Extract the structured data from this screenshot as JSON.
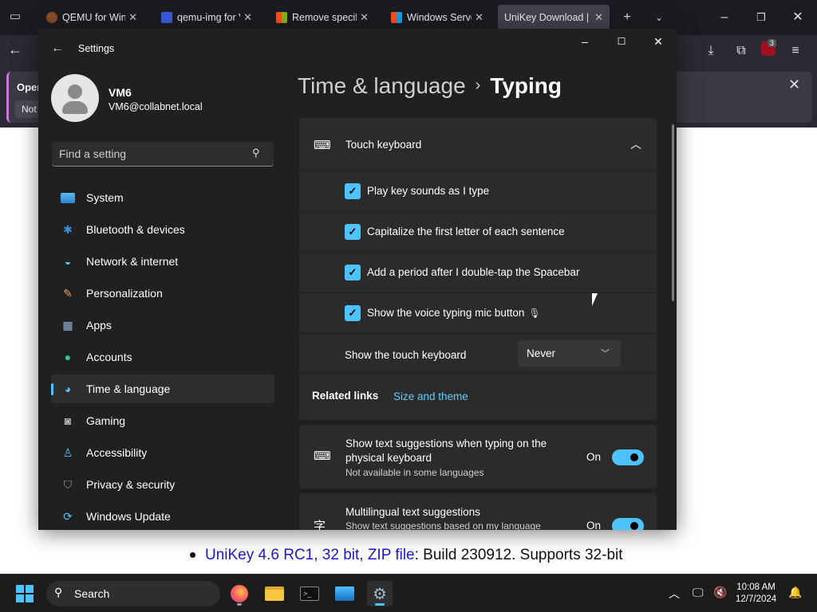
{
  "browser": {
    "tabs": [
      {
        "label": "QEMU for Wind",
        "fav_color": "#8b4a2b"
      },
      {
        "label": "qemu-img for V",
        "fav_color": "#3b5bdb"
      },
      {
        "label": "Remove specific",
        "fav_color": "#f25022"
      },
      {
        "label": "Windows Server",
        "fav_color": "#00a4ef"
      },
      {
        "label": "UniKey Download | ",
        "fav_color": ""
      }
    ],
    "notification": {
      "title": "Open",
      "button": "Not"
    },
    "badge_count": "3"
  },
  "page": {
    "bullet_link": "UniKey 4.6 RC1, 32 bit, ZIP file",
    "bullet_rest": ": Build 230912. Supports 32-bit"
  },
  "settings": {
    "title": "Settings",
    "user": {
      "name": "VM6",
      "email": "VM6@collabnet.local"
    },
    "search_placeholder": "Find a setting",
    "nav": [
      {
        "label": "System",
        "icon": "monitor-icon",
        "selected": false
      },
      {
        "label": "Bluetooth & devices",
        "icon": "bluetooth-icon",
        "selected": false
      },
      {
        "label": "Network & internet",
        "icon": "wifi-icon",
        "selected": false
      },
      {
        "label": "Personalization",
        "icon": "brush-icon",
        "selected": false
      },
      {
        "label": "Apps",
        "icon": "apps-icon",
        "selected": false
      },
      {
        "label": "Accounts",
        "icon": "person-icon",
        "selected": false
      },
      {
        "label": "Time & language",
        "icon": "globe-clock-icon",
        "selected": true
      },
      {
        "label": "Gaming",
        "icon": "gamepad-icon",
        "selected": false
      },
      {
        "label": "Accessibility",
        "icon": "accessibility-icon",
        "selected": false
      },
      {
        "label": "Privacy & security",
        "icon": "shield-icon",
        "selected": false
      },
      {
        "label": "Windows Update",
        "icon": "update-icon",
        "selected": false
      }
    ],
    "breadcrumb": {
      "parent": "Time & language",
      "separator": "›",
      "current": "Typing"
    },
    "touch_keyboard": {
      "title": "Touch keyboard",
      "options": [
        {
          "label": "Play key sounds as I type",
          "checked": true
        },
        {
          "label": "Capitalize the first letter of each sentence",
          "checked": true
        },
        {
          "label": "Add a period after I double-tap the Spacebar",
          "checked": true
        },
        {
          "label": "Show the voice typing mic button",
          "checked": true
        }
      ],
      "show_keyboard": {
        "label": "Show the touch keyboard",
        "value": "Never"
      },
      "related": {
        "label": "Related links",
        "link": "Size and theme"
      }
    },
    "text_suggestions": {
      "title": "Show text suggestions when typing on the physical keyboard",
      "subtitle": "Not available in some languages",
      "state": "On"
    },
    "multilingual": {
      "title": "Multilingual text suggestions",
      "subtitle": "Show text suggestions based on my language",
      "state": "On"
    }
  },
  "taskbar": {
    "search_label": "Search",
    "time": "10:08 AM",
    "date": "12/7/2024"
  },
  "colors": {
    "accent": "#4cc2ff",
    "link": "#60cdff",
    "window_bg": "#202020",
    "card_bg": "#2b2b2b"
  }
}
